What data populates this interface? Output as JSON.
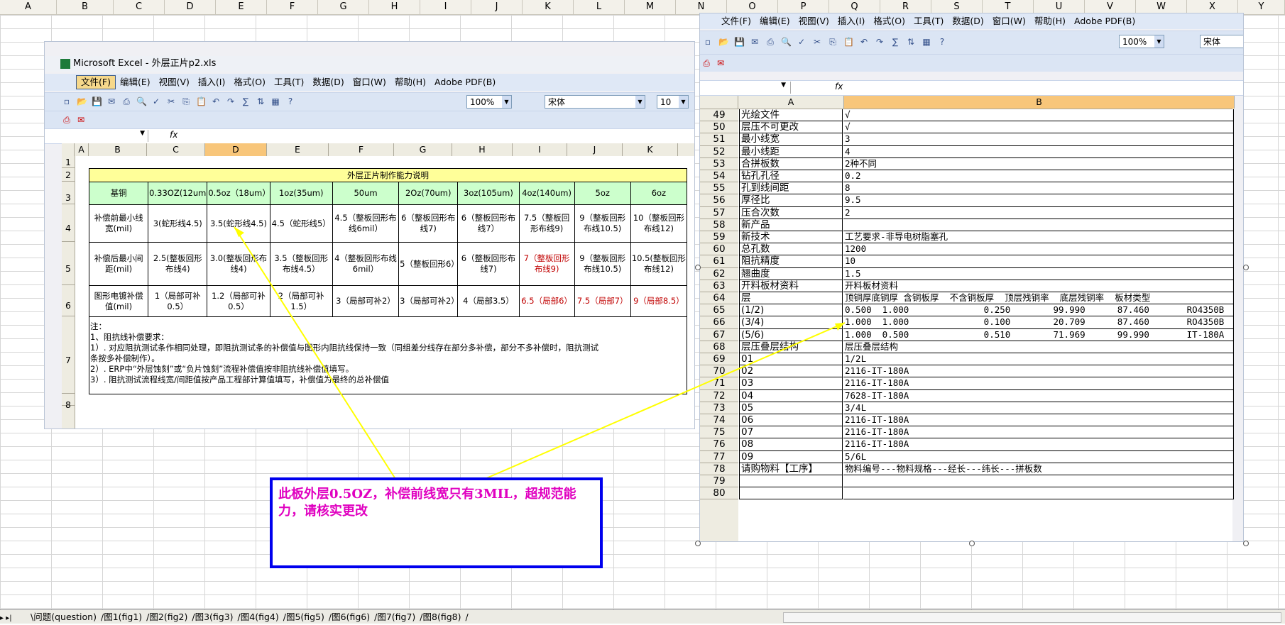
{
  "sheet_columns": [
    "A",
    "B",
    "C",
    "D",
    "E",
    "F",
    "G",
    "H",
    "I",
    "J",
    "K",
    "L",
    "M",
    "N",
    "O",
    "P",
    "Q",
    "R",
    "S",
    "T",
    "U",
    "V",
    "W",
    "X",
    "Y"
  ],
  "left_window": {
    "title": "Microsoft Excel - 外层正片p2.xls",
    "menu": [
      "文件(F)",
      "编辑(E)",
      "视图(V)",
      "插入(I)",
      "格式(O)",
      "工具(T)",
      "数据(D)",
      "窗口(W)",
      "帮助(H)",
      "Adobe PDF(B)"
    ],
    "zoom": "100%",
    "font_name": "宋体",
    "font_size": "10",
    "fx": "fx",
    "columns": [
      "A",
      "B",
      "C",
      "D",
      "E",
      "F",
      "G",
      "H",
      "I",
      "J",
      "K"
    ],
    "rows": [
      "1",
      "2",
      "3",
      "4",
      "5",
      "6",
      "7",
      "8"
    ],
    "table": {
      "title": "外层正片制作能力说明",
      "headers": [
        "基铜",
        "0.33OZ(12um)",
        "0.5oz（18um）",
        "1oz(35um)",
        "50um",
        "2Oz(70um)",
        "3oz(105um)",
        "4oz(140um)",
        "5oz",
        "6oz"
      ],
      "row1": [
        "补偿前最小线宽(mil)",
        "3(蛇形线4.5)",
        "3.5(蛇形线4.5)",
        "4.5（蛇形线5）",
        "4.5（整板回形布线6mil）",
        "6（整板回形布线7)",
        "6（整板回形布线7）",
        "7.5（整板回形布线9)",
        "9（整板回形布线10.5)",
        "10（整板回形布线12)"
      ],
      "row2": [
        "补偿后最小间距(mil)",
        "2.5(整板回形布线4)",
        "3.0(整板回形布线4)",
        "3.5（整板回形布线4.5）",
        "4（整板回形布线6mil）",
        "5（整板回形6）",
        "6（整板回形布线7)",
        "7（整板回形布线9)",
        "9（整板回形布线10.5)",
        "10.5(整板回形布线12)"
      ],
      "row3": [
        "图形电镀补偿值(mil)",
        "1（局部可补0.5）",
        "1.2（局部可补0.5）",
        "2（局部可补1.5）",
        "3（局部可补2）",
        "3（局部可补2）",
        "4（局部3.5）",
        "6.5（局部6）",
        "7.5（局部7）",
        "9（局部8.5）"
      ],
      "notes": [
        "注：",
        "1、阻抗线补偿要求：",
        "1）. 对应阻抗测试条作相同处理，即阻抗测试条的补偿值与图形内阻抗线保持一致（同组差分线存在部分多补偿，部分不多补偿时，阻抗测试",
        "条按多补偿制作）。",
        "2）. ERP中“外层蚀刻”或“负片蚀刻”流程补偿值按非阻抗线补偿值填写。",
        "3）. 阻抗测试流程线宽/间距值按产品工程部计算值填写，补偿值为最终的总补偿值"
      ]
    }
  },
  "right_window": {
    "menu": [
      "文件(F)",
      "编辑(E)",
      "视图(V)",
      "插入(I)",
      "格式(O)",
      "工具(T)",
      "数据(D)",
      "窗口(W)",
      "帮助(H)",
      "Adobe PDF(B)"
    ],
    "zoom": "100%",
    "font_name": "宋体",
    "fx": "fx",
    "col_a": "A",
    "col_b": "B",
    "rows": [
      {
        "n": "49",
        "a": "光绘文件",
        "b": "√"
      },
      {
        "n": "50",
        "a": "层压不可更改",
        "b": "√"
      },
      {
        "n": "51",
        "a": "最小线宽",
        "b": "3"
      },
      {
        "n": "52",
        "a": "最小线距",
        "b": "4"
      },
      {
        "n": "53",
        "a": "合拼板数",
        "b": "2种不同"
      },
      {
        "n": "54",
        "a": "钻孔孔径",
        "b": "0.2"
      },
      {
        "n": "55",
        "a": "孔到线间距",
        "b": "8"
      },
      {
        "n": "56",
        "a": "厚径比",
        "b": "9.5"
      },
      {
        "n": "57",
        "a": "压合次数",
        "b": "2"
      },
      {
        "n": "58",
        "a": "新产品",
        "b": ""
      },
      {
        "n": "59",
        "a": "新技术",
        "b": "工艺要求-非导电树脂塞孔"
      },
      {
        "n": "60",
        "a": "总孔数",
        "b": "1200"
      },
      {
        "n": "61",
        "a": "阻抗精度",
        "b": "10"
      },
      {
        "n": "62",
        "a": "翘曲度",
        "b": "1.5"
      },
      {
        "n": "63",
        "a": "开料板材资料",
        "b": "开料板材资料"
      },
      {
        "n": "64",
        "a": "层",
        "b": "顶铜厚底铜厚 含铜板厚  不含铜板厚  顶层残铜率  底层残铜率  板材类型"
      },
      {
        "n": "65",
        "a": "(1/2)",
        "b": "0.500  1.000              0.250        99.990      87.460       RO4350B"
      },
      {
        "n": "66",
        "a": "(3/4)",
        "b": "1.000  1.000              0.100        20.709      87.460       RO4350B"
      },
      {
        "n": "67",
        "a": "(5/6)",
        "b": "1.000  0.500              0.510        71.969      99.990       IT-180A"
      },
      {
        "n": "68",
        "a": "层压叠层结构",
        "b": "层压叠层结构"
      },
      {
        "n": "69",
        "a": "01",
        "b": "1/2L"
      },
      {
        "n": "70",
        "a": "02",
        "b": "2116-IT-180A"
      },
      {
        "n": "71",
        "a": "03",
        "b": "2116-IT-180A"
      },
      {
        "n": "72",
        "a": "04",
        "b": "7628-IT-180A"
      },
      {
        "n": "73",
        "a": "05",
        "b": "3/4L"
      },
      {
        "n": "74",
        "a": "06",
        "b": "2116-IT-180A"
      },
      {
        "n": "75",
        "a": "07",
        "b": "2116-IT-180A"
      },
      {
        "n": "76",
        "a": "08",
        "b": "2116-IT-180A"
      },
      {
        "n": "77",
        "a": "09",
        "b": "5/6L"
      },
      {
        "n": "78",
        "a": "请购物料【工序】",
        "b": "物料编号---物料规格---经长---纬长---拼板数"
      },
      {
        "n": "79",
        "a": "",
        "b": ""
      },
      {
        "n": "80",
        "a": "",
        "b": ""
      }
    ]
  },
  "callout": {
    "text": "此板外层0.5OZ，补偿前线宽只有3MIL，超规范能力，请核实更改",
    "arrow_color": "#ffff00",
    "border_color": "#0000ee",
    "text_color": "#e000c0"
  },
  "sheet_tabs": [
    "问题(question)",
    "图1(fig1)",
    "图2(fig2)",
    "图3(fig3)",
    "图4(fig4)",
    "图5(fig5)",
    "图6(fig6)",
    "图7(fig7)",
    "图8(fig8)"
  ]
}
